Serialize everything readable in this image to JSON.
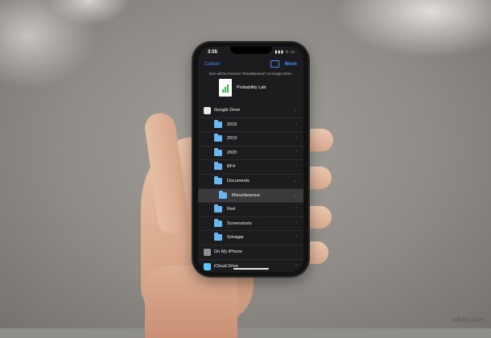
{
  "status_bar": {
    "time": "3:55",
    "icons": "▮▮▮ ≈ ▭"
  },
  "nav": {
    "cancel": "Cancel",
    "move": "Move"
  },
  "info_text": "Item will be moved to \"Miscellaneous\" on Google Drive.",
  "file": {
    "name": "Probability Lab"
  },
  "locations": [
    {
      "label": "Google Drive",
      "chevron": "⌄",
      "icon": "google-drive-icon"
    },
    {
      "label": "2018",
      "chevron": "›"
    },
    {
      "label": "2019",
      "chevron": "›"
    },
    {
      "label": "2020",
      "chevron": "›"
    },
    {
      "label": "BF4",
      "chevron": "›"
    },
    {
      "label": "Documents",
      "chevron": "⌄"
    },
    {
      "label": "Miscellaneous",
      "chevron": "⌄",
      "selected": true
    },
    {
      "label": "Red",
      "chevron": "›"
    },
    {
      "label": "Screenshots",
      "chevron": "›"
    },
    {
      "label": "Srinagar",
      "chevron": "›"
    },
    {
      "label": "On My iPhone",
      "chevron": "›",
      "icon": "iphone-icon"
    },
    {
      "label": "iCloud Drive",
      "chevron": "›",
      "icon": "icloud-icon"
    }
  ],
  "watermark": "wtvid.com",
  "colors": {
    "accent": "#3d8bff",
    "folder": "#6ab7ef",
    "screen_bg": "#1c1c1e"
  }
}
